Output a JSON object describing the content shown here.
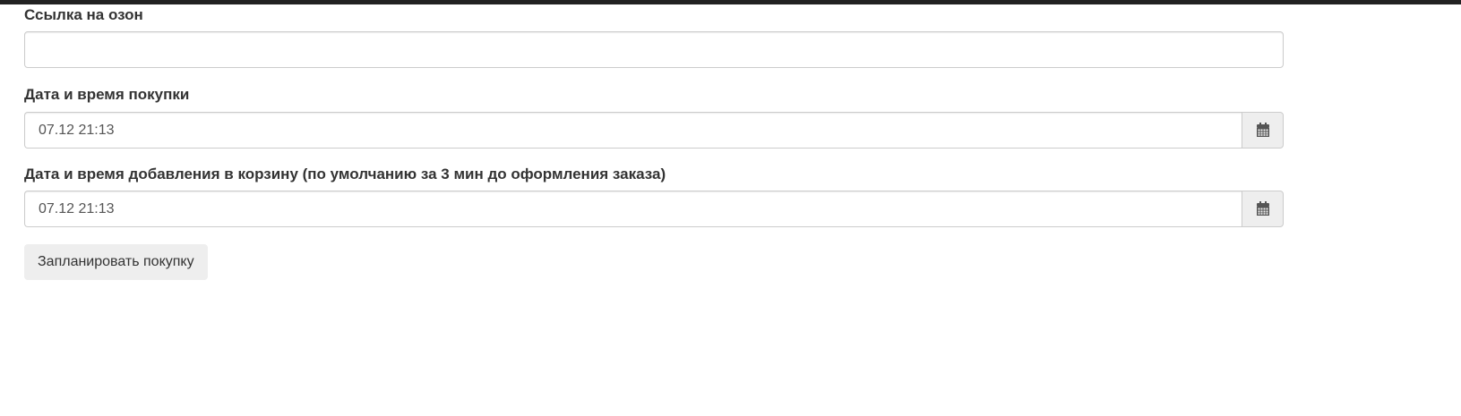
{
  "form": {
    "ozon_link": {
      "label": "Ссылка на озон",
      "value": ""
    },
    "purchase_datetime": {
      "label": "Дата и время покупки",
      "value": "07.12 21:13",
      "icon": "calendar-icon"
    },
    "cart_datetime": {
      "label": "Дата и время добавления в корзину (по умолчанию за 3 мин до оформления заказа)",
      "value": "07.12 21:13",
      "icon": "calendar-icon"
    },
    "submit_label": "Запланировать покупку"
  },
  "colors": {
    "top_bar": "#222222",
    "addon_bg": "#eeeeee",
    "border": "#cccccc",
    "button_bg": "#eeeeee",
    "icon": "#555555"
  }
}
